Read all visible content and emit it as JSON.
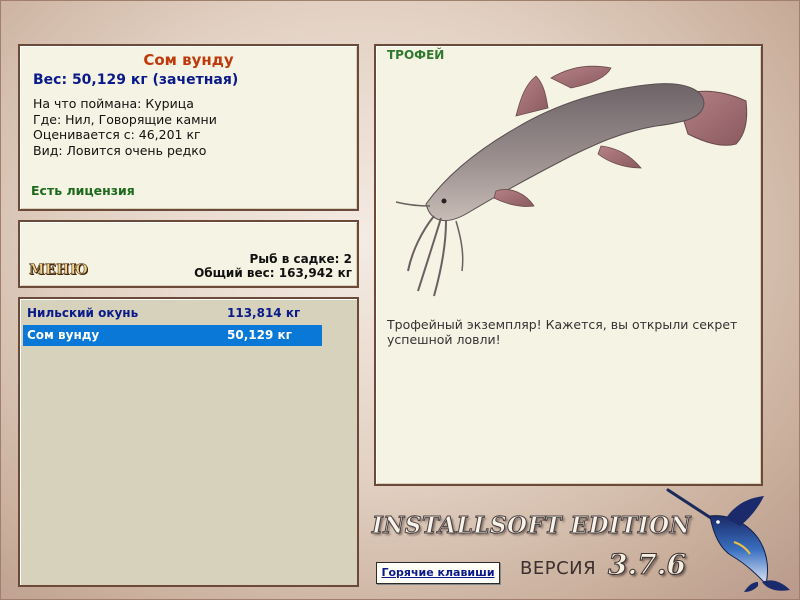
{
  "catch": {
    "title": "Сом вунду",
    "weight": "Вес: 50,129 кг (зачетная)",
    "bait": "На что поймана: Курица",
    "place": "Где: Нил, Говорящие камни",
    "rated": "Оценивается с: 46,201 кг",
    "kind": "Вид: Ловится очень редко",
    "license": "Есть лицензия"
  },
  "menu": {
    "button_label": "МЕНЮ",
    "fish_count": "Рыб в садке: 2",
    "total_weight": "Общий вес: 163,942 кг"
  },
  "cage_list": [
    {
      "name": "Нильский окунь",
      "weight": "113,814 кг",
      "selected": false
    },
    {
      "name": "Сом вунду",
      "weight": "50,129 кг",
      "selected": true
    }
  ],
  "trophy": {
    "label": "ТРОФЕЙ",
    "message": "Трофейный экземпляр! Кажется, вы открыли секрет успешной ловли!"
  },
  "footer": {
    "edition": "INSTALLSOFT EDITION",
    "hotkeys_label": "Горячие клавиши",
    "version_label": "ВЕРСИЯ",
    "version_number": "3.7.6"
  },
  "colors": {
    "title": "#c0390b",
    "weight": "#0a1a8a",
    "license": "#1d6a1d",
    "selection": "#0a78d6",
    "panel_border": "#6b4a3a"
  }
}
